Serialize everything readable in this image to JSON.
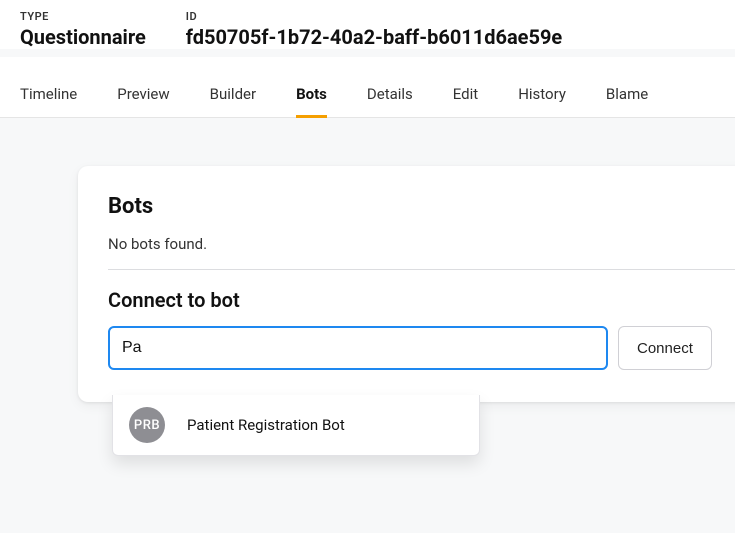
{
  "header": {
    "type_label": "TYPE",
    "type_value": "Questionnaire",
    "id_label": "ID",
    "id_value": "fd50705f-1b72-40a2-baff-b6011d6ae59e"
  },
  "tabs": [
    {
      "label": "Timeline",
      "active": false
    },
    {
      "label": "Preview",
      "active": false
    },
    {
      "label": "Builder",
      "active": false
    },
    {
      "label": "Bots",
      "active": true
    },
    {
      "label": "Details",
      "active": false
    },
    {
      "label": "Edit",
      "active": false
    },
    {
      "label": "History",
      "active": false
    },
    {
      "label": "Blame",
      "active": false
    }
  ],
  "card": {
    "bots_heading": "Bots",
    "bots_empty": "No bots found.",
    "connect_heading": "Connect to bot",
    "search_value": "Pa",
    "connect_button": "Connect"
  },
  "dropdown": {
    "items": [
      {
        "initials": "PRB",
        "label": "Patient Registration Bot"
      }
    ]
  }
}
